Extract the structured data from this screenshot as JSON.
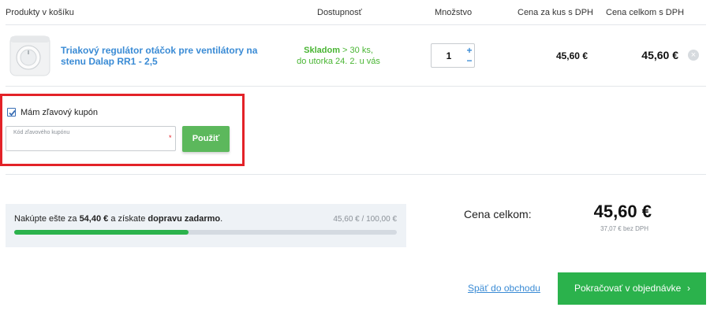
{
  "headers": {
    "products": "Produkty v košíku",
    "availability": "Dostupnosť",
    "quantity": "Množstvo",
    "unit_price": "Cena za kus s DPH",
    "total_price": "Cena celkom s DPH"
  },
  "item": {
    "icon": "fan-controller-image",
    "name": "Triakový regulátor otáčok pre ventilátory na stenu Dalap RR1 - 2,5",
    "stock_label": "Skladom",
    "stock_count": "> 30 ks,",
    "delivery": "do utorka 24. 2. u vás",
    "quantity": "1",
    "plus": "+",
    "minus": "−",
    "unit_price": "45,60 €",
    "total_price": "45,60 €",
    "remove": "×"
  },
  "coupon": {
    "checked": true,
    "label": "Mám zľavový kupón",
    "placeholder": "Kód zľavového kupónu",
    "required_mark": "*",
    "apply": "Použiť",
    "highlight_color": "#e32228"
  },
  "shipping": {
    "text_before": "Nakúpte ešte za",
    "remaining": "54,40 €",
    "text_middle": "a získate",
    "free_shipping": "dopravu zadarmo",
    "text_end": ".",
    "amount": "45,60 € / 100,00 €",
    "progress": 0.456
  },
  "summary": {
    "label": "Cena celkom:",
    "value": "45,60 €",
    "without_vat": "37,07 € bez DPH"
  },
  "actions": {
    "back": "Späť do obchodu",
    "continue": "Pokračovať v objednávke",
    "continue_arrow": "›"
  },
  "colors": {
    "accent_blue": "#3a8bd5",
    "green": "#2bb24c",
    "button_green": "#5cb85c"
  }
}
